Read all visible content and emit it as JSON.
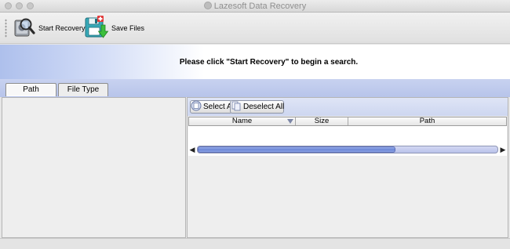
{
  "window": {
    "title": "Lazesoft Data Recovery"
  },
  "toolbar": {
    "start_recovery_label": "Start Recovery",
    "save_files_label": "Save Files"
  },
  "banner": {
    "message": "Please click \"Start Recovery\" to begin a search."
  },
  "tabs": [
    {
      "label": "Path",
      "active": true
    },
    {
      "label": "File Type",
      "active": false
    }
  ],
  "results": {
    "select_all_label": "Select All",
    "deselect_all_label": "Deselect All",
    "columns": [
      "Name",
      "Size",
      "Path"
    ],
    "rows": []
  },
  "scrollbar": {
    "position": 0.0,
    "visible_fraction": 0.66
  },
  "colors": {
    "banner_accent": "#aec0ec",
    "tab_strip": "#c0cbee",
    "scroll_thumb": "#6b86d6"
  },
  "icons": {
    "start_recovery": "magnifier-disk-icon",
    "save_files": "floppy-save-icon",
    "select_all": "select-all-icon",
    "deselect_all": "deselect-all-icon"
  }
}
